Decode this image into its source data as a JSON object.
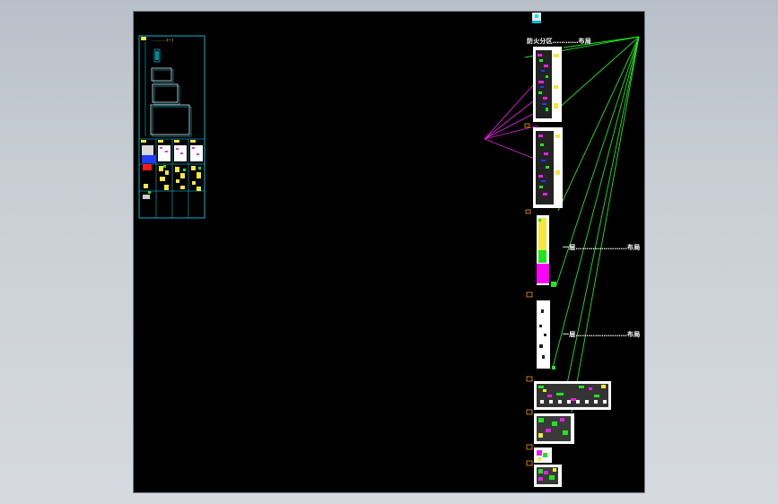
{
  "drawing": {
    "legend_sheet_title": "…………(一)",
    "labels": {
      "top_sheet_title": "防火分区…………布局",
      "mid_sheet_title": "一层……………………布局",
      "lower_sheet_title": "一层……………………布局"
    }
  },
  "colors": {
    "canvas_bg": "#000000",
    "frame_cyan": "#00e5ff",
    "line_green": "#1ee61e",
    "line_magenta": "#e61ee6",
    "accent_yellow": "#f5e63a",
    "accent_orange": "#ff9900"
  },
  "icons": {
    "compass_icon": "compass-icon"
  }
}
